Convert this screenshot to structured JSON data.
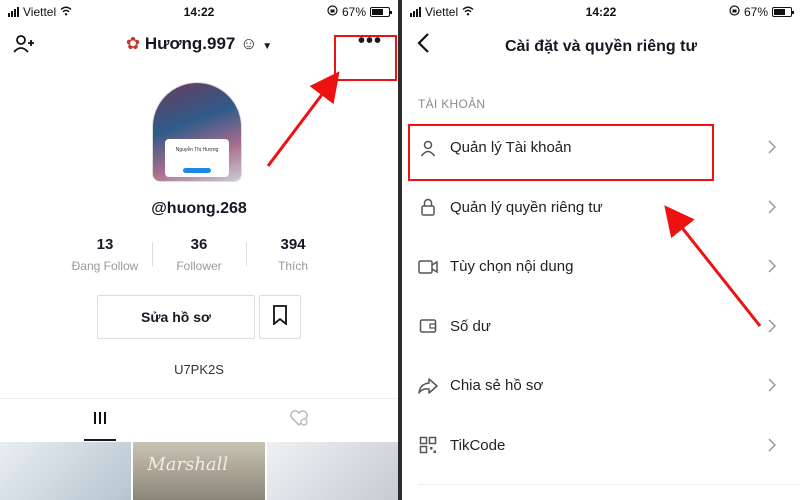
{
  "left": {
    "status": {
      "carrier": "Viettel",
      "time": "14:22",
      "battery": "67%",
      "battery_level": 0.67
    },
    "profile_name": "Hương.997",
    "username": "@huong.268",
    "stats": [
      {
        "value": "13",
        "label": "Đang Follow"
      },
      {
        "value": "36",
        "label": "Follower"
      },
      {
        "value": "394",
        "label": "Thích"
      }
    ],
    "edit_label": "Sửa hồ sơ",
    "code": "U7PK2S",
    "thumb_text": "Marshall",
    "avatar_caption": "Nguyễn Thị Hương"
  },
  "right": {
    "status": {
      "carrier": "Viettel",
      "time": "14:22",
      "battery": "67%",
      "battery_level": 0.67
    },
    "title": "Cài đặt và quyền riêng tư",
    "section": "TÀI KHOẢN",
    "items": [
      {
        "label": "Quản lý Tài khoản",
        "icon": "person-icon"
      },
      {
        "label": "Quản lý quyền riêng tư",
        "icon": "lock-icon"
      },
      {
        "label": "Tùy chọn nội dung",
        "icon": "video-icon"
      },
      {
        "label": "Số dư",
        "icon": "wallet-icon"
      },
      {
        "label": "Chia sẻ hồ sơ",
        "icon": "share-icon"
      },
      {
        "label": "TikCode",
        "icon": "qr-icon"
      }
    ]
  },
  "colors": {
    "annotation": "#e11111",
    "muted": "#8a8b91"
  }
}
